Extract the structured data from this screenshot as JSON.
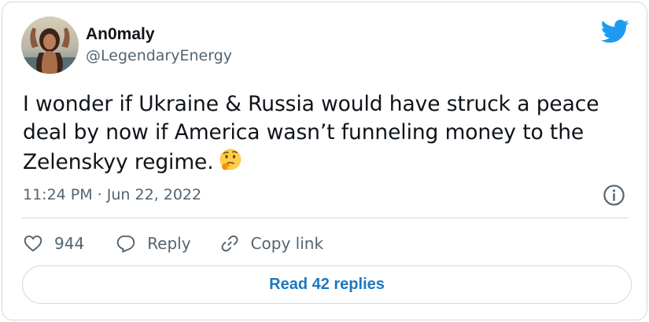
{
  "author": {
    "display_name": "An0maly",
    "handle": "@LegendaryEnergy"
  },
  "tweet": {
    "text": "I wonder if Ukraine & Russia would have struck a peace deal by now if America wasn’t funneling money to the Zelenskyy regime.",
    "emoji": "thinking-face-emoji",
    "timestamp": "11:24 PM · Jun 22, 2022"
  },
  "actions": {
    "like_count": "944",
    "reply_label": "Reply",
    "copy_link_label": "Copy link"
  },
  "footer": {
    "read_replies_label": "Read 42 replies"
  },
  "colors": {
    "brand_blue": "#1d9bf0",
    "link_blue": "#1d78bd",
    "secondary_text": "#536471",
    "border": "#cfd9de"
  },
  "icons": [
    "twitter-bird-icon",
    "info-icon",
    "heart-icon",
    "reply-bubble-icon",
    "link-icon"
  ]
}
